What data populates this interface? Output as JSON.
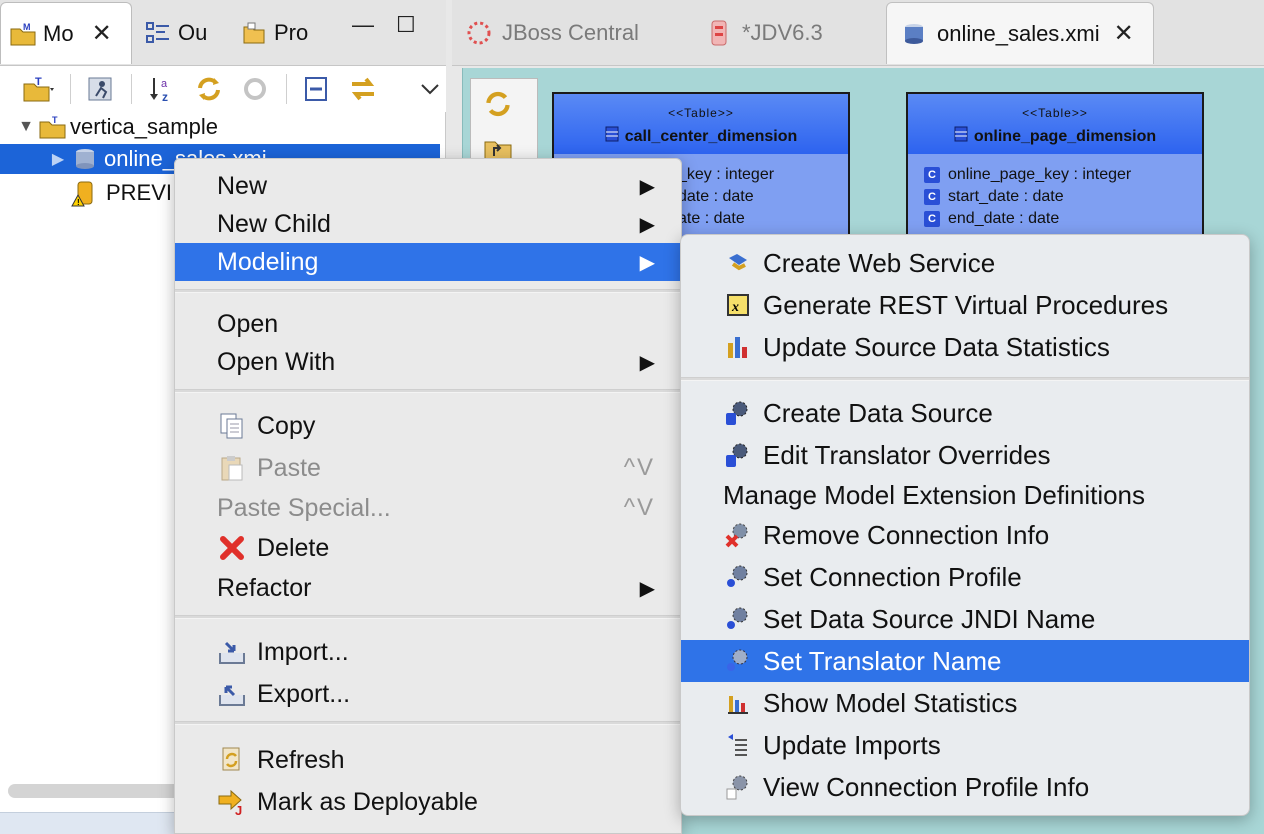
{
  "left_tabs": [
    {
      "label": "Mo",
      "icon": "model-explorer-icon",
      "closable": true
    },
    {
      "label": "Ou",
      "icon": "outline-icon"
    },
    {
      "label": "Pro",
      "icon": "properties-icon"
    }
  ],
  "window_controls": {
    "minimize": "—",
    "maximize": "☐"
  },
  "toolbar_icons": [
    "new-model-icon",
    "run-icon",
    "sort-az-icon",
    "sync-icon",
    "refresh-disabled-icon",
    "collapse-all-icon",
    "link-with-editor-icon",
    "view-menu-icon"
  ],
  "tree": {
    "project": "vertica_sample",
    "model": "online_sales.xmi",
    "other": "PREVI"
  },
  "editor_tabs": [
    {
      "label": "JBoss Central",
      "icon": "jboss-central-icon",
      "active": false
    },
    {
      "label": "*JDV6.3",
      "icon": "vdb-icon",
      "active": false
    },
    {
      "label": "online_sales.xmi",
      "icon": "model-file-icon",
      "active": true,
      "closable": true
    }
  ],
  "diagram": {
    "tables": [
      {
        "stereotype": "<<Table>>",
        "name": "call_center_dimension",
        "columns": [
          "_key : integer",
          "date : date",
          "ate : date"
        ]
      },
      {
        "stereotype": "<<Table>>",
        "name": "online_page_dimension",
        "columns": [
          "online_page_key : integer",
          "start_date : date",
          "end_date : date"
        ]
      }
    ]
  },
  "context_menu": {
    "items": [
      {
        "label": "New",
        "submenu": true
      },
      {
        "label": "New Child",
        "submenu": true
      },
      {
        "label": "Modeling",
        "submenu": true,
        "highlighted": true
      },
      {
        "label": "Open"
      },
      {
        "label": "Open With",
        "submenu": true
      },
      {
        "label": "Copy",
        "icon": "copy-icon"
      },
      {
        "label": "Paste",
        "icon": "paste-icon",
        "disabled": true,
        "shortcut": "^V"
      },
      {
        "label": "Paste Special...",
        "disabled": true,
        "shortcut": "^V"
      },
      {
        "label": "Delete",
        "icon": "delete-icon"
      },
      {
        "label": "Refactor",
        "submenu": true
      },
      {
        "label": "Import...",
        "icon": "import-icon"
      },
      {
        "label": "Export...",
        "icon": "export-icon"
      },
      {
        "label": "Refresh",
        "icon": "refresh-icon"
      },
      {
        "label": "Mark as Deployable",
        "icon": "mark-deployable-icon"
      }
    ]
  },
  "modeling_submenu": {
    "items": [
      {
        "label": "Create Web Service",
        "icon": "web-service-icon"
      },
      {
        "label": "Generate REST Virtual Procedures",
        "icon": "rest-procedure-icon"
      },
      {
        "label": "Update Source Data Statistics",
        "icon": "statistics-update-icon"
      },
      {
        "label": "Create Data Source",
        "icon": "data-source-icon"
      },
      {
        "label": "Edit Translator Overrides",
        "icon": "translator-overrides-icon"
      },
      {
        "label": "Manage Model Extension Definitions"
      },
      {
        "label": "Remove Connection Info",
        "icon": "remove-connection-icon"
      },
      {
        "label": "Set Connection Profile",
        "icon": "connection-profile-icon"
      },
      {
        "label": "Set Data Source JNDI Name",
        "icon": "jndi-icon"
      },
      {
        "label": "Set Translator Name",
        "icon": "translator-icon",
        "highlighted": true
      },
      {
        "label": "Show Model Statistics",
        "icon": "model-statistics-icon"
      },
      {
        "label": "Update Imports",
        "icon": "update-imports-icon"
      },
      {
        "label": "View Connection Profile Info",
        "icon": "connection-info-icon"
      }
    ]
  },
  "colors": {
    "selection": "#1c64d8",
    "menu_highlight": "#2f73e8",
    "diagram_bg": "#a8d6d6",
    "table_fill": "#7f9ff2"
  }
}
